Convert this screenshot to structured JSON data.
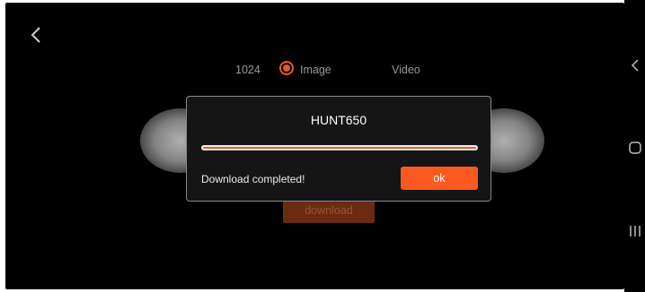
{
  "toolbar": {
    "back_icon": "chevron-left-icon"
  },
  "mode": {
    "resolution": "1024",
    "options": [
      {
        "label": "Image",
        "selected": true
      },
      {
        "label": "Video",
        "selected": false
      }
    ]
  },
  "main": {
    "download_label": "download"
  },
  "dialog": {
    "title": "HUNT650",
    "progress": 1.0,
    "status": "Download completed!",
    "ok_label": "ok"
  },
  "system_nav": {
    "icons": [
      "back-nav-icon",
      "home-nav-icon",
      "recents-nav-icon"
    ]
  },
  "colors": {
    "accent": "#fa5a1f",
    "background": "#000000",
    "dialog_bg": "#151515"
  }
}
